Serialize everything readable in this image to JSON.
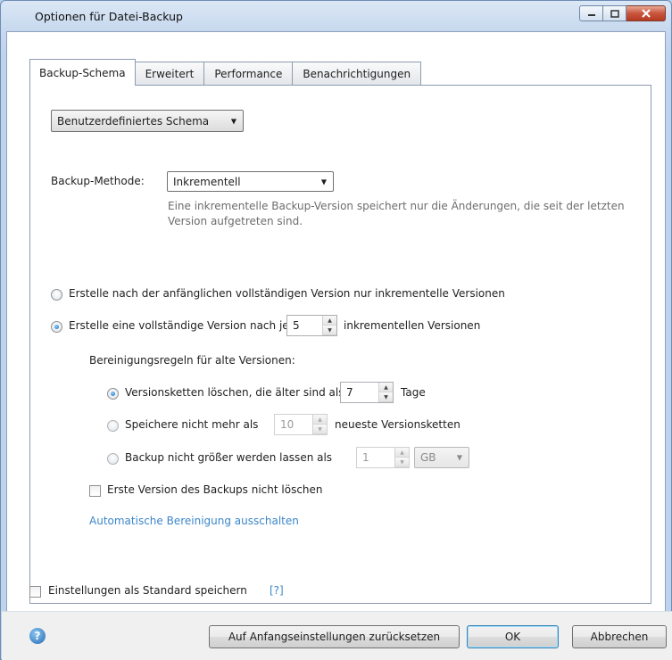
{
  "window": {
    "title": "Optionen für Datei-Backup",
    "buttons": {
      "minimize": "minimize-icon",
      "maximize": "maximize-icon",
      "close": "close-icon"
    }
  },
  "tabs": [
    {
      "label": "Backup-Schema",
      "active": true
    },
    {
      "label": "Erweitert",
      "active": false
    },
    {
      "label": "Performance",
      "active": false
    },
    {
      "label": "Benachrichtigungen",
      "active": false
    }
  ],
  "scheme": {
    "selected": "Benutzerdefiniertes Schema"
  },
  "method": {
    "label": "Backup-Methode:",
    "selected": "Inkrementell",
    "description": "Eine inkrementelle Backup-Version speichert nur die Änderungen, die seit der letzten Version aufgetreten sind."
  },
  "options": {
    "only_incremental": {
      "label": "Erstelle nach der anfänglichen vollständigen Version nur inkrementelle Versionen",
      "checked": false
    },
    "full_every": {
      "prefix": "Erstelle eine vollständige Version nach je",
      "value": "5",
      "suffix": "inkrementellen Versionen",
      "checked": true
    }
  },
  "cleanup": {
    "heading": "Bereinigungsregeln für alte Versionen:",
    "delete_older": {
      "prefix": "Versionsketten löschen, die älter sind als",
      "value": "7",
      "suffix": "Tage",
      "checked": true
    },
    "keep_max": {
      "prefix": "Speichere nicht mehr als",
      "value": "10",
      "suffix": "neueste Versionsketten",
      "checked": false
    },
    "size_limit": {
      "prefix": "Backup nicht größer werden lassen als",
      "value": "1",
      "unit": "GB",
      "checked": false
    },
    "keep_first": {
      "label": "Erste Version des Backups nicht löschen",
      "checked": false
    },
    "disable_link": "Automatische Bereinigung ausschalten"
  },
  "footer": {
    "save_default": {
      "label": "Einstellungen als Standard speichern",
      "help_link": "[?]",
      "checked": false
    },
    "help_icon": "?",
    "reset_button": "Auf Anfangseinstellungen zurücksetzen",
    "ok_button": "OK",
    "cancel_button": "Abbrechen"
  },
  "colors": {
    "link": "#3b86c8",
    "accent": "#1a67b5",
    "title_bar": "#c9daef"
  }
}
